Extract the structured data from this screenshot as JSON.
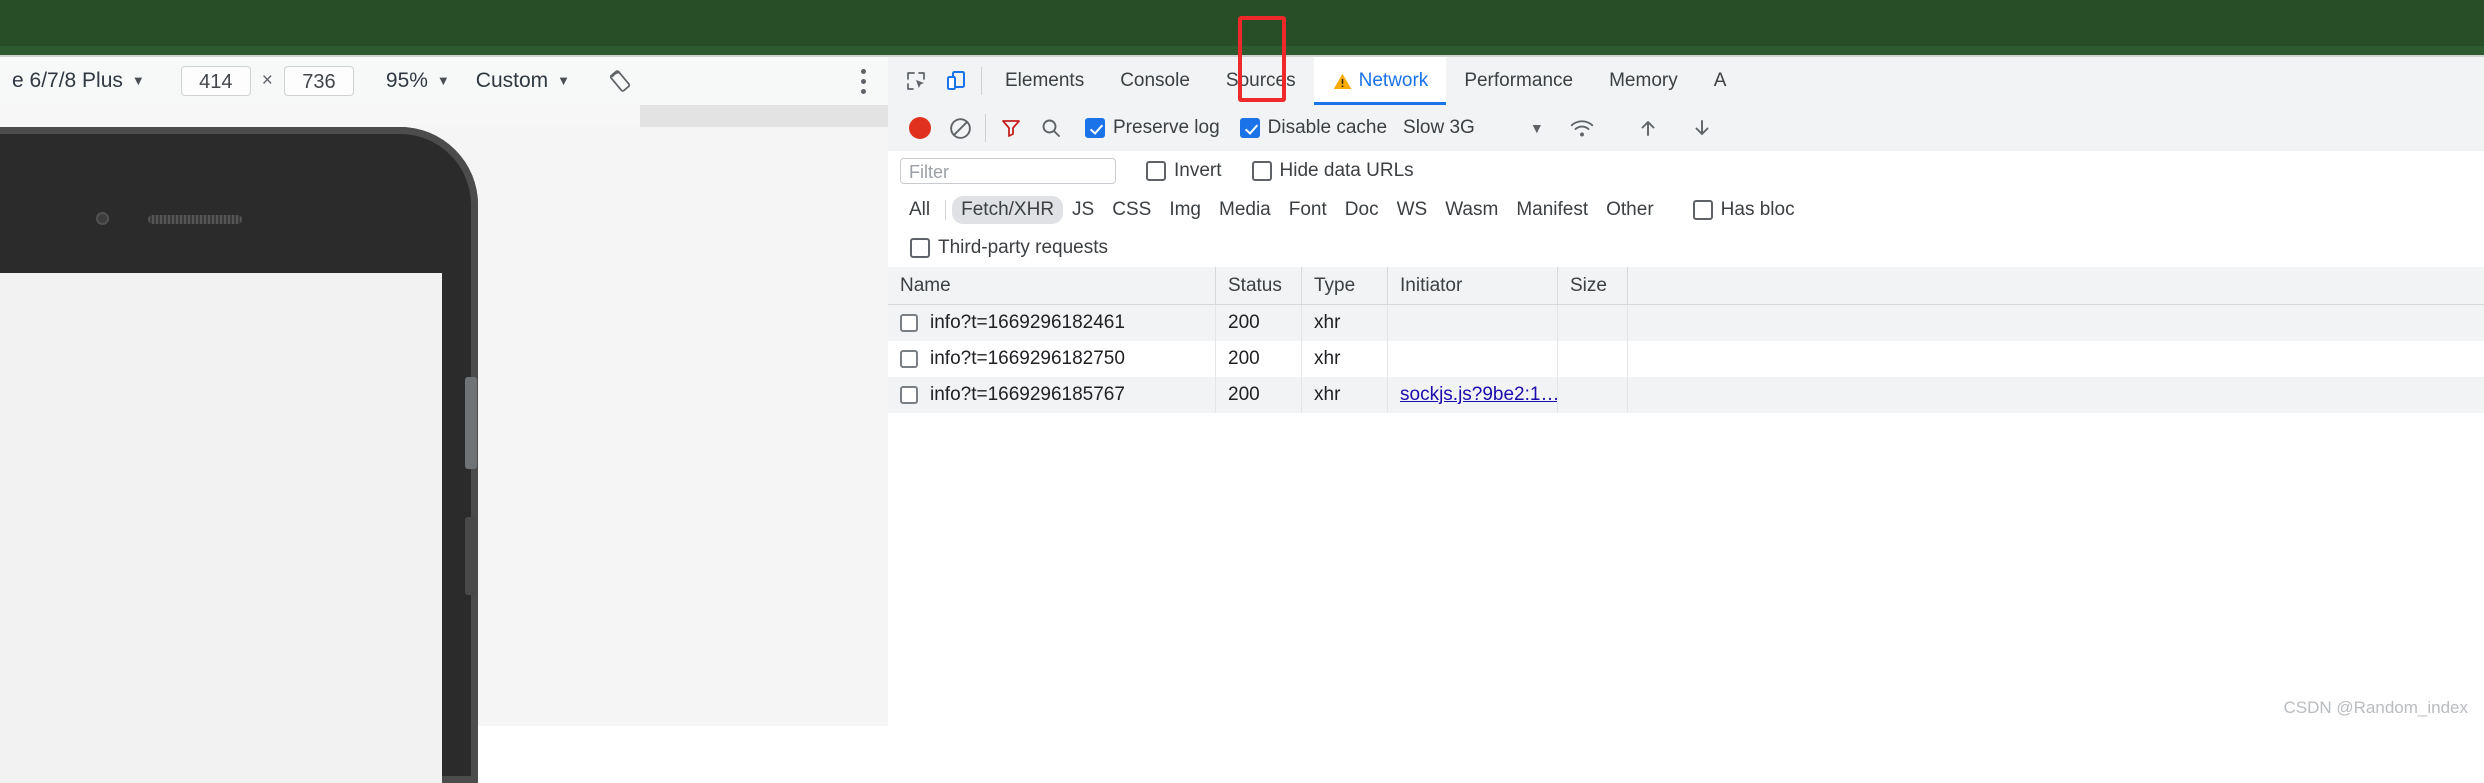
{
  "browser": {
    "chrome_color": "#274e27"
  },
  "device_toolbar": {
    "device_name": "e 6/7/8 Plus",
    "width": "414",
    "height": "736",
    "times_symbol": "×",
    "zoom": "95%",
    "throttle_preset": "Custom",
    "caret": "▼",
    "rotate_icon": "rotate-device-icon",
    "more_icon": "kebab-menu-icon"
  },
  "devtools": {
    "inspect_icon": "inspect-element-icon",
    "device_toggle_icon": "toggle-device-toolbar-icon",
    "tabs": [
      {
        "label": "Elements",
        "active": false,
        "warn": false
      },
      {
        "label": "Console",
        "active": false,
        "warn": false
      },
      {
        "label": "Sources",
        "active": false,
        "warn": false
      },
      {
        "label": "Network",
        "active": true,
        "warn": true
      },
      {
        "label": "Performance",
        "active": false,
        "warn": false
      },
      {
        "label": "Memory",
        "active": false,
        "warn": false
      },
      {
        "label": "A",
        "active": false,
        "warn": false
      }
    ],
    "warn_icon": "warning-triangle-icon",
    "network_toolbar": {
      "record_icon": "record-button",
      "clear_icon": "clear-icon",
      "filter_icon": "filter-funnel-icon",
      "search_icon": "search-icon",
      "preserve_log_label": "Preserve log",
      "preserve_log_checked": true,
      "disable_cache_label": "Disable cache",
      "disable_cache_checked": true,
      "throttling_value": "Slow 3G",
      "throttling_caret": "▼",
      "wifi_icon": "network-conditions-icon",
      "upload_icon": "import-har-icon",
      "download_icon": "export-har-icon"
    },
    "filter_bar": {
      "placeholder": "Filter",
      "invert_label": "Invert",
      "invert_checked": false,
      "hide_data_urls_label": "Hide data URLs",
      "hide_data_urls_checked": false,
      "has_blocked_label": "Has bloc",
      "has_blocked_checked": false,
      "third_party_label": "Third-party requests",
      "third_party_checked": false
    },
    "type_filters": [
      {
        "label": "All",
        "selected": false
      },
      {
        "label": "Fetch/XHR",
        "selected": true
      },
      {
        "label": "JS",
        "selected": false
      },
      {
        "label": "CSS",
        "selected": false
      },
      {
        "label": "Img",
        "selected": false
      },
      {
        "label": "Media",
        "selected": false
      },
      {
        "label": "Font",
        "selected": false
      },
      {
        "label": "Doc",
        "selected": false
      },
      {
        "label": "WS",
        "selected": false
      },
      {
        "label": "Wasm",
        "selected": false
      },
      {
        "label": "Manifest",
        "selected": false
      },
      {
        "label": "Other",
        "selected": false
      }
    ],
    "table": {
      "columns": [
        "Name",
        "Status",
        "Type",
        "Initiator",
        "Size"
      ],
      "rows": [
        {
          "name": "info?t=1669296182461",
          "status": "200",
          "type": "xhr",
          "initiator": "",
          "size": ""
        },
        {
          "name": "info?t=1669296182750",
          "status": "200",
          "type": "xhr",
          "initiator": "",
          "size": ""
        },
        {
          "name": "info?t=1669296185767",
          "status": "200",
          "type": "xhr",
          "initiator": "sockjs.js?9be2:1…",
          "size": ""
        }
      ]
    },
    "watermark": "CSDN @Random_index"
  },
  "annotation": {
    "highlight_color": "#ef2929",
    "target": "network-tab-warning"
  }
}
